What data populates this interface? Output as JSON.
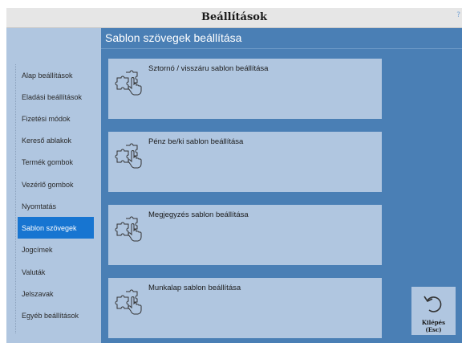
{
  "window": {
    "title": "Beállítások",
    "corner_mark": "?"
  },
  "sidebar": {
    "items": [
      {
        "label": "Alap beállítások"
      },
      {
        "label": "Eladási beállítások"
      },
      {
        "label": "Fizetési módok"
      },
      {
        "label": "Kereső ablakok"
      },
      {
        "label": "Termék gombok"
      },
      {
        "label": "Vezérlő gombok"
      },
      {
        "label": "Nyomtatás"
      },
      {
        "label": "Sablon szövegek",
        "active": true
      },
      {
        "label": "Jogcímek"
      },
      {
        "label": "Valuták"
      },
      {
        "label": "Jelszavak"
      },
      {
        "label": "Egyéb beállítások"
      }
    ]
  },
  "main": {
    "title": "Sablon szövegek beállítása",
    "cards": [
      {
        "label": "Sztornó / visszáru sablon beállítása",
        "icon": "puzzle-hand-icon"
      },
      {
        "label": "Pénz be/ki sablon beállítása",
        "icon": "puzzle-hand-icon"
      },
      {
        "label": "Megjegyzés sablon beállítása",
        "icon": "puzzle-hand-icon"
      },
      {
        "label": "Munkalap sablon beállítása",
        "icon": "puzzle-hand-icon"
      }
    ]
  },
  "exit_button": {
    "label_line1": "Kilépés",
    "label_line2": "(Esc)",
    "icon": "undo-arrow-icon"
  },
  "colors": {
    "accent": "#1775d1",
    "panel": "#b0c6e0",
    "background": "#4a7fb5"
  }
}
